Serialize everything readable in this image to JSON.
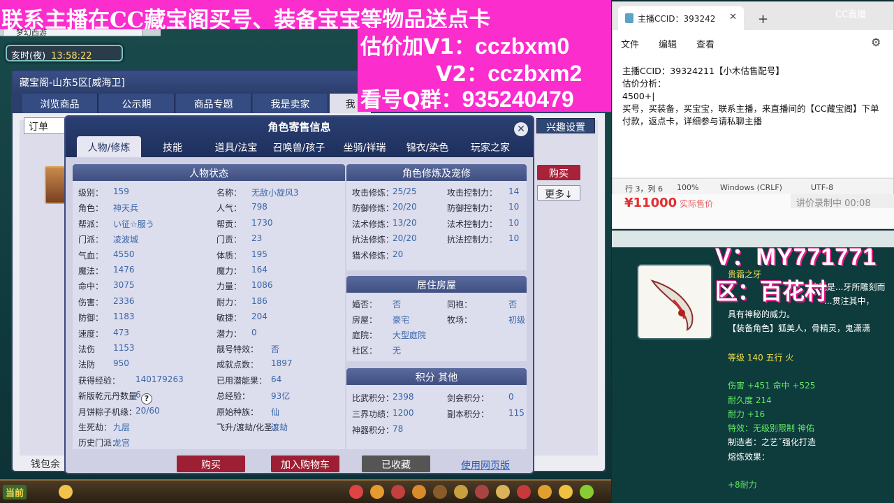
{
  "promo": {
    "line1": "联系主播在CC藏宝阁买号、装备宝宝等物品送点卡",
    "line2_prefix": "估价加V1：",
    "line2_id": "cczbxm0",
    "line3_prefix": "V2：",
    "line3_id": "cczbxm2",
    "line4_prefix": "看号Q群：",
    "line4_id": "935240479"
  },
  "game": {
    "clock_label": "亥时(夜)",
    "clock_time": "13:58:22",
    "tab_label": "梦幻西游"
  },
  "treasure": {
    "title": "藏宝阁-山东5区[威海卫]",
    "tabs": [
      "浏览商品",
      "公示期",
      "商品专题",
      "我是卖家",
      "我"
    ],
    "order_label": "订单",
    "interest_label": "兴趣设置",
    "buy_label": "购买",
    "more_label": "更多↓",
    "wallet_label": "钱包余"
  },
  "bottom_bar": {
    "current_label": "当前"
  },
  "modal": {
    "title": "角色寄售信息",
    "tabs": [
      "人物/修炼",
      "技能",
      "道具/法宝",
      "召唤兽/孩子",
      "坐骑/祥瑞",
      "锦衣/染色",
      "玩家之家"
    ],
    "status_title": "人物状态",
    "left_col": [
      {
        "k": "级别：",
        "v": "159"
      },
      {
        "k": "角色：",
        "v": "神天兵"
      },
      {
        "k": "帮派：",
        "v": "い征☆服う"
      },
      {
        "k": "门派：",
        "v": "凌波城"
      },
      {
        "k": "气血：",
        "v": "4550"
      },
      {
        "k": "魔法：",
        "v": "1476"
      },
      {
        "k": "命中：",
        "v": "3075"
      },
      {
        "k": "伤害：",
        "v": "2336"
      },
      {
        "k": "防御：",
        "v": "1183"
      },
      {
        "k": "速度：",
        "v": "473"
      },
      {
        "k": "法伤",
        "v": "1153"
      },
      {
        "k": "法防",
        "v": "950"
      },
      {
        "k": "获得经验：",
        "v": "140179263"
      },
      {
        "k": "新版乾元丹数量",
        "v": "6"
      },
      {
        "k": "月饼粽子机缘：",
        "v": "20/60"
      },
      {
        "k": "生死劫：",
        "v": "九层"
      },
      {
        "k": "历史门派：",
        "v": "龙宫"
      }
    ],
    "mid_col": [
      {
        "k": "名称：",
        "v": "无敌小旋风3"
      },
      {
        "k": "人气：",
        "v": "798"
      },
      {
        "k": "帮贡：",
        "v": "1730"
      },
      {
        "k": "门贡：",
        "v": "23"
      },
      {
        "k": "体质：",
        "v": "195"
      },
      {
        "k": "魔力：",
        "v": "164"
      },
      {
        "k": "力量：",
        "v": "1086"
      },
      {
        "k": "耐力：",
        "v": "186"
      },
      {
        "k": "敏捷：",
        "v": "204"
      },
      {
        "k": "潜力：",
        "v": "0"
      },
      {
        "k": "靓号特效：",
        "v": "否"
      },
      {
        "k": "成就点数：",
        "v": "1897"
      },
      {
        "k": "已用潜能果：",
        "v": "64"
      },
      {
        "k": "总经验：",
        "v": "93亿"
      },
      {
        "k": "原始种族：",
        "v": "仙"
      },
      {
        "k": "飞升/渡劫/化圣：",
        "v": "渡劫"
      }
    ],
    "cultivation_title": "角色修炼及宠修",
    "cultivation": [
      {
        "k": "攻击修炼：",
        "v": "25/25",
        "k2": "攻击控制力：",
        "v2": "14"
      },
      {
        "k": "防御修炼：",
        "v": "20/20",
        "k2": "防御控制力：",
        "v2": "10"
      },
      {
        "k": "法术修炼：",
        "v": "13/20",
        "k2": "法术控制力：",
        "v2": "10"
      },
      {
        "k": "抗法修炼：",
        "v": "20/20",
        "k2": "抗法控制力：",
        "v2": "10"
      },
      {
        "k": "猎术修炼：",
        "v": "20",
        "k2": "",
        "v2": ""
      }
    ],
    "house_title": "居住房屋",
    "house": [
      {
        "k": "婚否：",
        "v": "否",
        "k2": "同袍：",
        "v2": "否"
      },
      {
        "k": "房屋：",
        "v": "豪宅",
        "k2": "牧场：",
        "v2": "初级"
      },
      {
        "k": "庭院：",
        "v": "大型庭院",
        "k2": "",
        "v2": ""
      },
      {
        "k": "社区：",
        "v": "无",
        "k2": "",
        "v2": ""
      }
    ],
    "score_title": "积分 其他",
    "score": [
      {
        "k": "比武积分：",
        "v": "2398",
        "k2": "剑会积分：",
        "v2": "0"
      },
      {
        "k": "三界功绩：",
        "v": "1200",
        "k2": "副本积分：",
        "v2": "115"
      },
      {
        "k": "神器积分：",
        "v": "78",
        "k2": "",
        "v2": ""
      }
    ],
    "btn_buy": "购买",
    "btn_cart": "加入购物车",
    "btn_fav": "已收藏",
    "web_link": "使用网页版"
  },
  "notepad": {
    "tab_title": "主播CCID：393242",
    "menu": [
      "文件",
      "编辑",
      "查看"
    ],
    "lines": [
      "主播CCID：39324211【小木估售配号】",
      "估价分析：",
      "4500+|",
      "买号，买装备，买宝宝，联系主播，来直播间的【CC藏宝阁】下单付款，返点卡，详细参与请私聊主播"
    ],
    "status": [
      "行 3，列 6",
      "100%",
      "Windows (CRLF)",
      "UTF-8"
    ]
  },
  "cc": {
    "logo": "CC直播",
    "corner": "CC直播"
  },
  "listing": {
    "price": "¥11000",
    "price_note": "实际售价",
    "bargain": "讲价录制中 00:08"
  },
  "overlay_tags": {
    "v_tag": "V：MY771771",
    "area_tag": "区：百花村"
  },
  "item": {
    "name": "贵霜之牙",
    "desc_1": "传说是...牙所雕刻而",
    "desc_2": "...贯注其中，",
    "desc_3": "具有神秘的威力。",
    "equip_role": "【装备角色】狐美人，骨精灵，鬼潇潇",
    "level": "等级 140  五行 火",
    "attr": "伤害 +451 命中 +525",
    "durability": "耐久度 214",
    "endurance": "耐力 +16",
    "special": "特效：无级别限制 神佑",
    "maker": "制造者：之艺ˇ强化打造",
    "melt_label": "熔炼效果：",
    "melt_value": "+8耐力"
  }
}
